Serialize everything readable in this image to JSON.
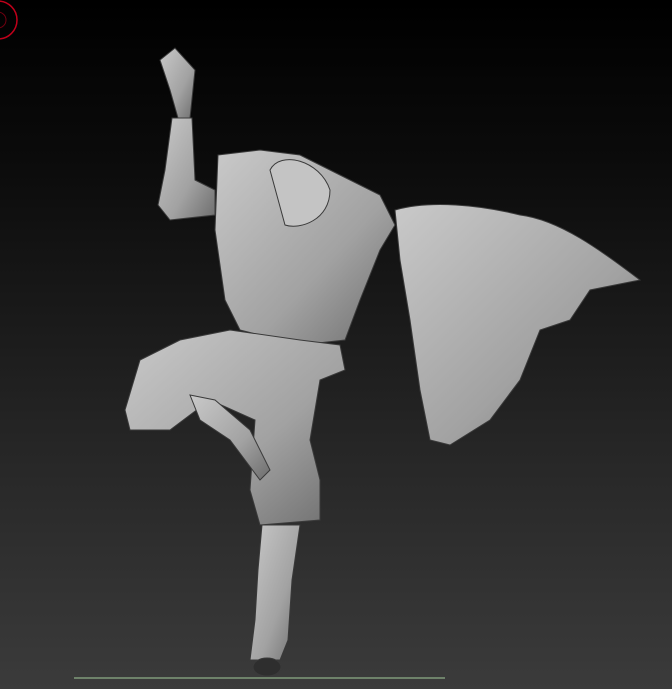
{
  "viewport": {
    "background_top": "#000000",
    "background_bottom": "#3b3b3b",
    "model_color": "#a9a9a9",
    "model_shadow": "#6e6e6e",
    "floor_grid_color": "#7f9a7a",
    "cursor_color": "#c0001a"
  },
  "icons": [
    "brush-cursor-icon",
    "floor-grid-icon",
    "sculpt-model-icon"
  ]
}
